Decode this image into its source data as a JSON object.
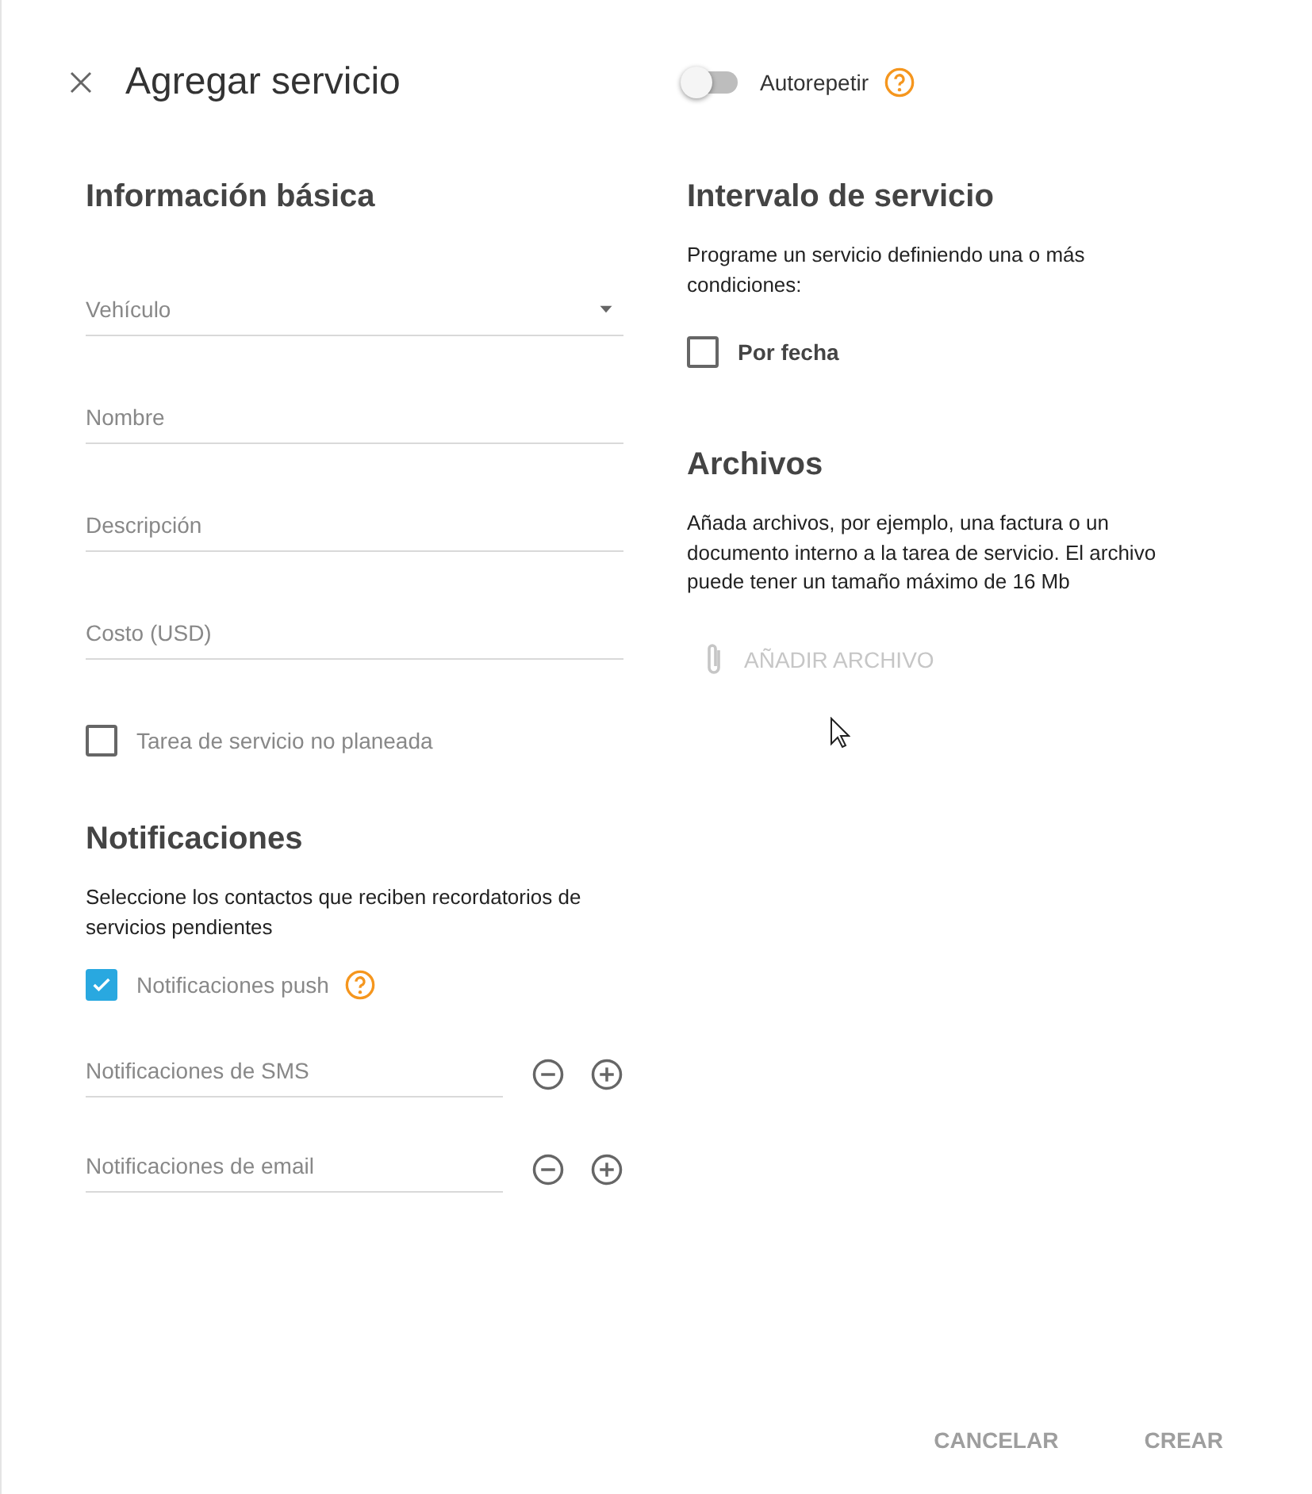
{
  "header": {
    "title": "Agregar servicio",
    "autorepeat": {
      "label": "Autorepetir",
      "on": false
    }
  },
  "basic": {
    "heading": "Información básica",
    "fields": [
      {
        "kind": "select",
        "placeholder": "Vehículo"
      },
      {
        "kind": "text",
        "placeholder": "Nombre"
      },
      {
        "kind": "text",
        "placeholder": "Descripción"
      },
      {
        "kind": "text",
        "placeholder": "Costo (USD)"
      }
    ],
    "unplanned": {
      "label": "Tarea de servicio no planeada",
      "checked": false
    }
  },
  "notifications": {
    "heading": "Notificaciones",
    "description": "Seleccione los contactos que reciben recordatorios de servicios pendientes",
    "push": {
      "label": "Notificaciones push",
      "checked": true
    },
    "channels": [
      {
        "placeholder": "Notificaciones de SMS"
      },
      {
        "placeholder": "Notificaciones de email"
      }
    ]
  },
  "interval": {
    "heading": "Intervalo de servicio",
    "description": "Programe un servicio definiendo una o más condiciones:",
    "by_date": {
      "label": "Por fecha",
      "checked": false
    }
  },
  "files": {
    "heading": "Archivos",
    "description": "Añada archivos, por ejemplo, una factura o un documento interno a la tarea de servicio. El archivo puede tener un tamaño máximo de 16 Mb",
    "add_button": {
      "label": "AÑADIR ARCHIVO",
      "disabled": true
    }
  },
  "actions": [
    {
      "label": "CANCELAR"
    },
    {
      "label": "CREAR"
    }
  ]
}
